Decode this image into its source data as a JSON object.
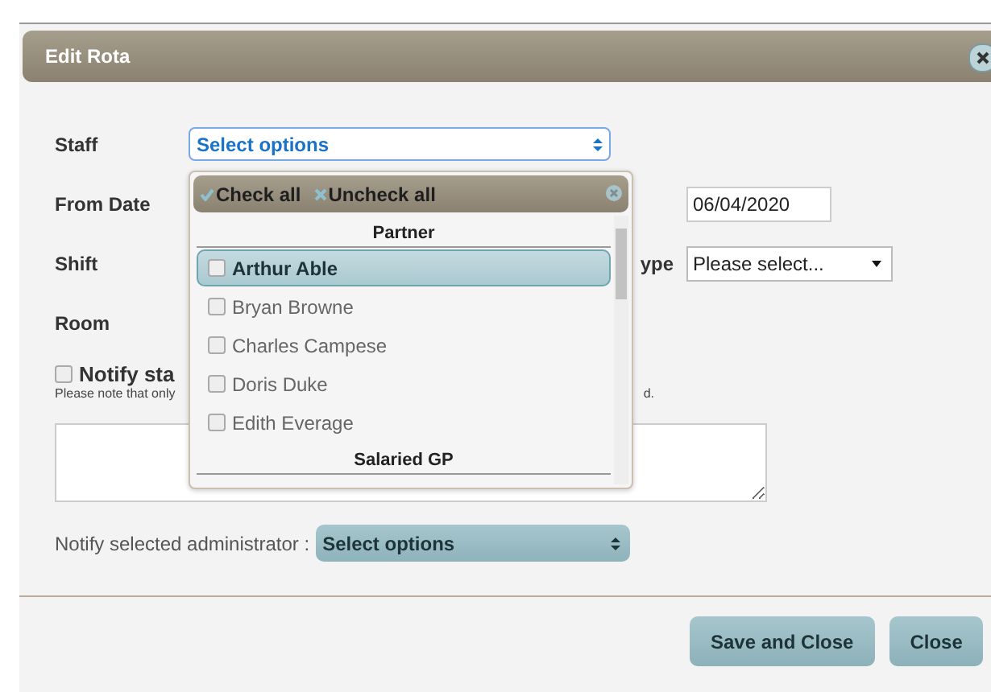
{
  "dialog": {
    "title": "Edit Rota"
  },
  "form": {
    "staff_label": "Staff",
    "staff_select": "Select options",
    "from_date_label": "From Date",
    "from_date": "06/04/2020",
    "shift_label": "Shift",
    "type_label": "ype",
    "type_select": "Please select...",
    "room_label": "Room"
  },
  "notify": {
    "label": "Notify sta",
    "checked": false,
    "note": "Please note that only",
    "note_end": "d."
  },
  "admin": {
    "label": "Notify selected administrator :",
    "select": "Select options"
  },
  "dropdown": {
    "check_all": "Check all",
    "uncheck_all": "Uncheck all",
    "groups": [
      {
        "name": "Partner",
        "items": [
          {
            "name": "Arthur Able",
            "selected": true,
            "checked": false
          },
          {
            "name": "Bryan Browne",
            "selected": false,
            "checked": false
          },
          {
            "name": "Charles Campese",
            "selected": false,
            "checked": false
          },
          {
            "name": "Doris Duke",
            "selected": false,
            "checked": false
          },
          {
            "name": "Edith Everage",
            "selected": false,
            "checked": false
          }
        ]
      },
      {
        "name": "Salaried GP"
      }
    ]
  },
  "buttons": [
    "Save and Close",
    "Close"
  ]
}
